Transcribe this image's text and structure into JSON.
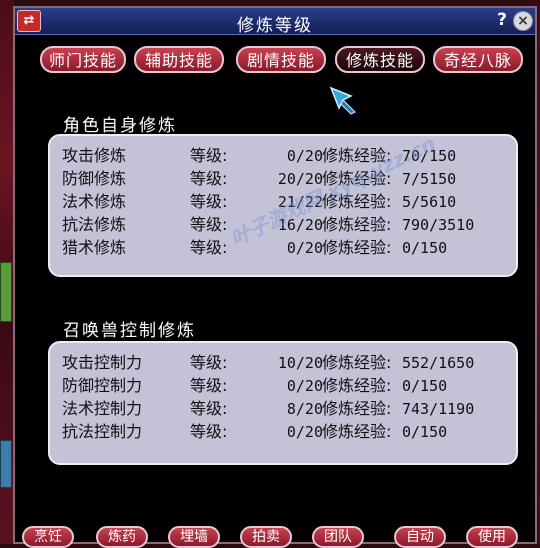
{
  "window": {
    "title": "修炼等级",
    "help_label": "?",
    "close_label": "×",
    "menu_icon": "⇄"
  },
  "tabs": [
    {
      "label": "师门技能",
      "active": false
    },
    {
      "label": "辅助技能",
      "active": false
    },
    {
      "label": "剧情技能",
      "active": false
    },
    {
      "label": "修炼技能",
      "active": true
    },
    {
      "label": "奇经八脉",
      "active": false
    }
  ],
  "character_section": {
    "title": "角色自身修炼",
    "level_label": "等级:",
    "exp_label": "修炼经验:",
    "rows": [
      {
        "name": "攻击修炼",
        "level": "0/20",
        "exp": "70/150"
      },
      {
        "name": "防御修炼",
        "level": "20/20",
        "exp": "7/5150"
      },
      {
        "name": "法术修炼",
        "level": "21/22",
        "exp": "5/5610"
      },
      {
        "name": "抗法修炼",
        "level": "16/20",
        "exp": "790/3510"
      },
      {
        "name": "猎术修炼",
        "level": "0/20",
        "exp": "0/150"
      }
    ]
  },
  "pet_section": {
    "title": "召唤兽控制修炼",
    "level_label": "等级:",
    "exp_label": "修炼经验:",
    "rows": [
      {
        "name": "攻击控制力",
        "level": "10/20",
        "exp": "552/1650"
      },
      {
        "name": "防御控制力",
        "level": "0/20",
        "exp": "0/150"
      },
      {
        "name": "法术控制力",
        "level": "8/20",
        "exp": "743/1190"
      },
      {
        "name": "抗法控制力",
        "level": "0/20",
        "exp": "0/150"
      }
    ]
  },
  "watermark": "叶子游戏网 xyq.yzz.cn",
  "bottom_buttons": [
    "烹饪",
    "炼药",
    "埋墙",
    "拍卖",
    "团队",
    "自动",
    "使用"
  ],
  "colors": {
    "title_bar": "#1b2a6a",
    "tab_red": "#8a1a2a",
    "panel_bg": "#c4c2d6",
    "window_bg": "#000000"
  }
}
